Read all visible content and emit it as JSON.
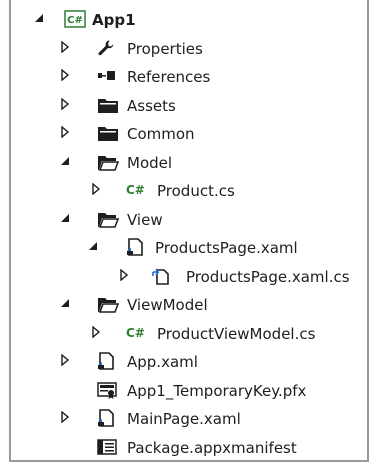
{
  "tree": {
    "root": {
      "label": "App1",
      "badge": "C#"
    },
    "items": [
      {
        "label": "Properties"
      },
      {
        "label": "References"
      },
      {
        "label": "Assets"
      },
      {
        "label": "Common"
      },
      {
        "label": "Model"
      },
      {
        "label": "Product.cs",
        "badge": "C#"
      },
      {
        "label": "View"
      },
      {
        "label": "ProductsPage.xaml"
      },
      {
        "label": "ProductsPage.xaml.cs"
      },
      {
        "label": "ViewModel"
      },
      {
        "label": "ProductViewModel.cs",
        "badge": "C#"
      },
      {
        "label": "App.xaml"
      },
      {
        "label": "App1_TemporaryKey.pfx"
      },
      {
        "label": "MainPage.xaml"
      },
      {
        "label": "Package.appxmanifest"
      }
    ]
  },
  "colors": {
    "csharp_green": "#2e7d32",
    "folder": "#1e1e1e",
    "link_blue": "#1e6fd9"
  }
}
